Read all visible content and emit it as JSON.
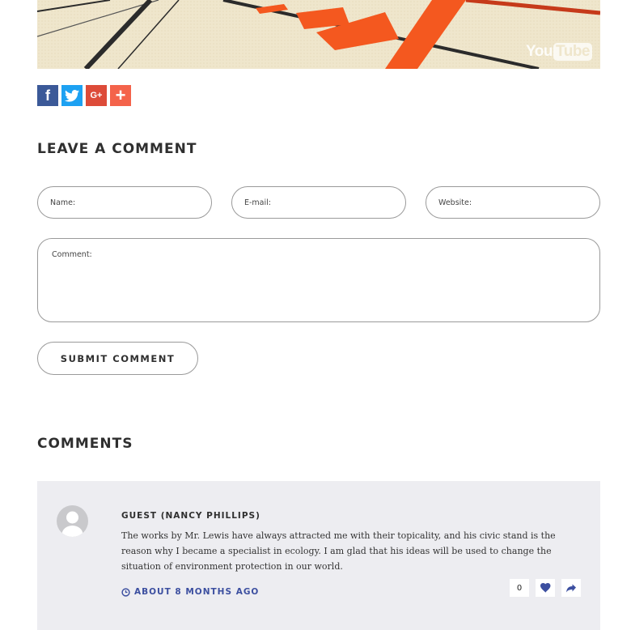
{
  "video": {
    "brand_left": "You",
    "brand_right": "Tube"
  },
  "share": {
    "icons": [
      "facebook-icon",
      "twitter-icon",
      "google-plus-icon",
      "plus-icon"
    ],
    "facebook_glyph": "f",
    "google_plus_glyph": "G+",
    "more_glyph": "+",
    "colors": {
      "facebook": "#3b5998",
      "twitter": "#1da1f2",
      "google_plus": "#dd4b39",
      "more": "#f4634b"
    }
  },
  "leave_comment": {
    "title": "LEAVE A COMMENT",
    "name_placeholder": "Name:",
    "email_placeholder": "E-mail:",
    "website_placeholder": "Website:",
    "comment_placeholder": "Comment:",
    "submit_label": "SUBMIT COMMENT"
  },
  "comments": {
    "title": "COMMENTS",
    "items": [
      {
        "author": "GUEST (NANCY PHILLIPS)",
        "text": "The works by Mr. Lewis have always attracted me with their topicality, and his civic stand is the reason why I became a specialist in ecology. I am glad that his ideas will be used to change the situation of environment protection in our world.",
        "time": "ABOUT 8 MONTHS AGO",
        "likes": "0"
      }
    ]
  },
  "colors": {
    "accent_blue": "#3c4fa0",
    "banner_orange": "#f4581f",
    "comment_bg": "#ededf1"
  }
}
